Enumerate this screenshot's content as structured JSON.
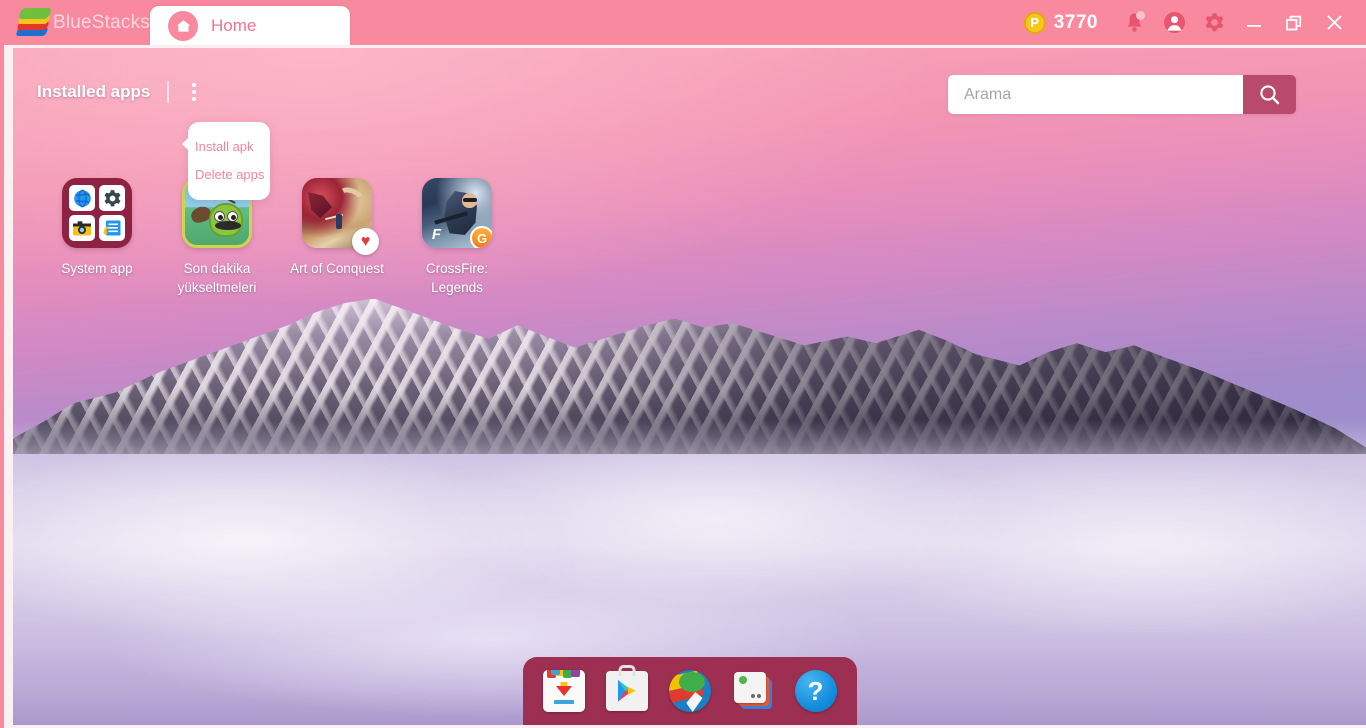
{
  "window": {
    "brand": "BlueStacks",
    "brand_logo_icon": "bluestacks-logo-icon",
    "tabs": [
      {
        "label": "Home",
        "icon": "home-icon",
        "active": true
      }
    ],
    "points": {
      "value": "3770",
      "coin_symbol": "P",
      "coin_icon": "points-coin-icon"
    },
    "controls": [
      {
        "name": "notifications-button",
        "icon": "bell-icon",
        "has_dot": true
      },
      {
        "name": "profile-button",
        "icon": "user-avatar-icon"
      },
      {
        "name": "settings-button",
        "icon": "gear-icon"
      },
      {
        "name": "minimize-button",
        "icon": "minimize-icon"
      },
      {
        "name": "restore-button",
        "icon": "restore-icon"
      },
      {
        "name": "close-button",
        "icon": "close-icon"
      }
    ],
    "colors": {
      "titlebar": "#f9899f",
      "tab_active_bg": "#ffffff",
      "tab_active_text": "#f4728d",
      "accent_dark": "#b94a6b",
      "dock_bg": "#9d3052",
      "folder_bg": "#8d2242"
    }
  },
  "header": {
    "installed_apps_label": "Installed apps",
    "kebab_icon": "more-vertical-icon",
    "menu": {
      "open": true,
      "items": [
        {
          "label": "Install apk"
        },
        {
          "label": "Delete apps"
        }
      ]
    }
  },
  "search": {
    "placeholder": "Arama",
    "value": "",
    "button_icon": "search-icon"
  },
  "apps": [
    {
      "name": "system-app",
      "label": "System app",
      "type": "folder",
      "tiles": [
        {
          "icon": "browser-globe-icon"
        },
        {
          "icon": "settings-gear-icon"
        },
        {
          "icon": "camera-icon"
        },
        {
          "icon": "media-notes-icon"
        }
      ]
    },
    {
      "name": "son-dakika-yukseltmeleri",
      "label": "Son dakika\nyükseltmeleri",
      "type": "game"
    },
    {
      "name": "art-of-conquest",
      "label": "Art of Conquest",
      "type": "game",
      "badge": {
        "icon": "heart-badge-icon",
        "glyph": "♥"
      }
    },
    {
      "name": "crossfire-legends",
      "label": "CrossFire:\nLegends",
      "type": "game",
      "badge": {
        "icon": "tencent-badge-icon",
        "glyph": "G"
      }
    }
  ],
  "dock": {
    "items": [
      {
        "name": "app-center-button",
        "icon": "app-store-download-icon"
      },
      {
        "name": "google-play-button",
        "icon": "google-play-icon"
      },
      {
        "name": "browser-button",
        "icon": "globe-browser-icon"
      },
      {
        "name": "media-manager-button",
        "icon": "media-stack-icon"
      },
      {
        "name": "help-button",
        "icon": "help-question-icon",
        "glyph": "?"
      }
    ]
  }
}
